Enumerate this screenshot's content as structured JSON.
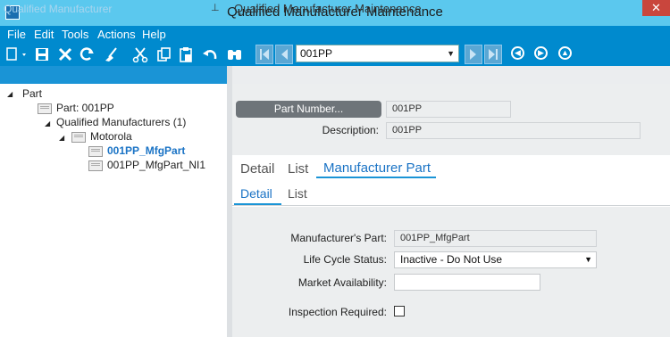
{
  "window": {
    "title": "Qualified Manufacturer Maintenance",
    "close_glyph": "✕"
  },
  "menu": [
    "File",
    "Edit",
    "Tools",
    "Actions",
    "Help"
  ],
  "toolbar": {
    "icons": [
      "new-icon",
      "save-icon",
      "delete-icon",
      "refresh-icon",
      "clear-icon",
      "cut-icon",
      "copy-icon",
      "paste-icon",
      "undo-icon",
      "search-icon"
    ],
    "record_combo_value": "001PP",
    "nav_icons": [
      "first-record-icon",
      "previous-record-icon",
      "next-record-icon",
      "last-record-icon",
      "back-icon",
      "forward-icon",
      "home-icon"
    ]
  },
  "left_panel": {
    "title": "Qualified Manufacturer",
    "tree": [
      {
        "label": "Part",
        "expanded": true
      },
      {
        "label": "Part: 001PP"
      },
      {
        "label": "Qualified Manufacturers (1)",
        "expanded": true
      },
      {
        "label": "Motorola",
        "expanded": true
      },
      {
        "label": "001PP_MfgPart",
        "selected": true
      },
      {
        "label": "001PP_MfgPart_NI1"
      }
    ]
  },
  "right_panel": {
    "title": "Qualified Manufacturer Maintenance",
    "part_number_button": "Part Number...",
    "part_number_value": "001PP",
    "description_label": "Description:",
    "description_value": "001PP",
    "tabs": [
      {
        "label": "Detail",
        "active": false
      },
      {
        "label": "List",
        "active": false
      },
      {
        "label": "Manufacturer Part",
        "active": true
      }
    ],
    "subtabs": [
      {
        "label": "Detail",
        "active": true
      },
      {
        "label": "List",
        "active": false
      }
    ],
    "form": {
      "mfg_part_label": "Manufacturer's Part:",
      "mfg_part_value": "001PP_MfgPart",
      "life_cycle_label": "Life Cycle Status:",
      "life_cycle_value": "Inactive - Do Not Use",
      "market_label": "Market Availability:",
      "market_value": "",
      "inspection_label": "Inspection Required:",
      "inspection_checked": false
    }
  },
  "colors": {
    "titlebar": "#5bc8ee",
    "toolbar": "#008ace",
    "accent": "#1a73c5",
    "selected_tree": "#1a73c5"
  }
}
